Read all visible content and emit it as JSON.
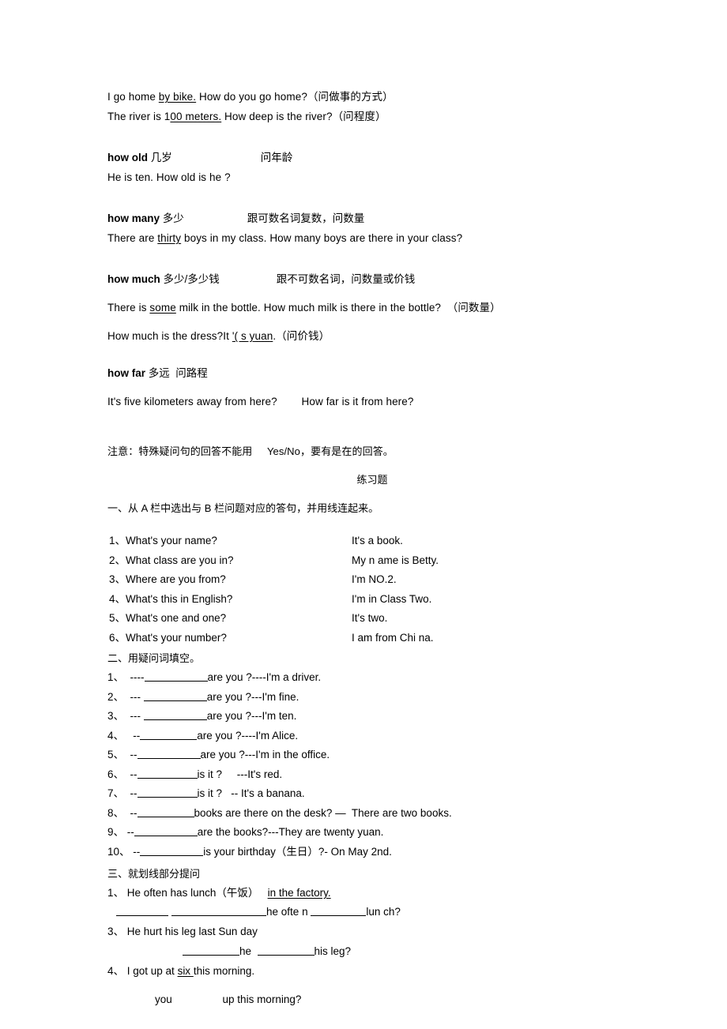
{
  "document": {
    "intro_examples": [
      {
        "pre": "I go home ",
        "underlined": "by bike.",
        "post": " How do you go home?（问做事的方式）"
      },
      {
        "pre": "The river is 1",
        "underlined": "00 meters.",
        "post": " How deep is the river?（问程度）"
      }
    ],
    "entries": [
      {
        "term": "how old",
        "cn_meaning": " 几岁",
        "note": "问年龄",
        "examples": [
          "He is ten. How old is he ?"
        ]
      },
      {
        "term": "how many",
        "cn_meaning": " 多少",
        "note": "跟可数名词复数，问数量",
        "examples": [
          "There are thirty boys in my class. How many boys are there in your class?"
        ],
        "example_underline": "thirty"
      },
      {
        "term": "how much",
        "cn_meaning": " 多少/多少钱",
        "note": "跟不可数名词，问数量或价钱",
        "examples": [
          "There is some milk in the bottle. How much milk is there in the bottle?（问数量）",
          "How much is the dress?"
        ]
      },
      {
        "term": "how far",
        "cn_meaning": " 多远  问路程",
        "note": "",
        "examples": [
          "It's five kilometers away from here?        How far is it from here?"
        ]
      }
    ],
    "how_much_extra": {
      "q": "How much is the dress?",
      "a_pre": "It ",
      "a_underlined": "'( s yuan",
      "a_post": ".（问价钱）"
    },
    "milk_example": {
      "pre": "There is ",
      "underlined": "some",
      "post": " milk in the bottle. How much milk is there in the bottle?  （问数量）"
    },
    "many_example": {
      "pre": "There are ",
      "underlined": "thirty",
      "post": " boys in my class. How many boys are there in your class?"
    },
    "note_line": "注意：特殊疑问句的回答不能用     Yes/No，要有是在的回答。",
    "practice_title": "练习题",
    "section_one": {
      "heading": "一、从 A 栏中选出与 B 栏问题对应的答句，并用线连起来。",
      "rows": [
        {
          "left": "1、What's your name?",
          "right": "It's a book."
        },
        {
          "left": "2、What class are you in?",
          "right": "My n ame is Betty."
        },
        {
          "left": "3、Where are you from?",
          "right": "I'm NO.2."
        },
        {
          "left": "4、What's this in English?",
          "right": "I'm in Class Two."
        },
        {
          "left": "5、What's one and one?",
          "right": "It's two."
        },
        {
          "left": "6、What's your number?",
          "right": "I am from Chi na."
        }
      ]
    },
    "section_two": {
      "heading": "二、用疑问词填空。",
      "items": [
        {
          "num": "1、",
          "pre": "  ----",
          "blank": 80,
          "post": "are you ?----I'm a driver."
        },
        {
          "num": "2、",
          "pre": "  --- ",
          "blank": 80,
          "post": "are you ?---I'm fine."
        },
        {
          "num": "3、",
          "pre": "  --- ",
          "blank": 80,
          "post": "are you ?---I'm ten."
        },
        {
          "num": "4、",
          "pre": "   --",
          "blank": 72,
          "post": "are you ?----I'm Alice."
        },
        {
          "num": "5、",
          "pre": "  --",
          "blank": 80,
          "post": "are you ?---I'm in the office."
        },
        {
          "num": "6、",
          "pre": "  --",
          "blank": 76,
          "post": "is it ?     ---It's red."
        },
        {
          "num": "7、",
          "pre": "  --",
          "blank": 76,
          "post": "is it ?   -- It's a banana."
        },
        {
          "num": "8、",
          "pre": "  --",
          "blank": 72,
          "post": "books are there on the desk? —  There are two books."
        },
        {
          "num": "9、",
          "pre": " --",
          "blank": 80,
          "post": "are the books?---They are twenty yuan."
        },
        {
          "num": "10、",
          "pre": " --",
          "blank": 80,
          "post": "is your birthday（生日）?‐ On May 2nd."
        }
      ]
    },
    "section_three": {
      "heading": "三、就划线部分提问",
      "items": [
        {
          "num": "1、",
          "text_pre": " He often has lunch（午饭）   ",
          "text_underlined": "in the factory.",
          "answer_pre": "   ",
          "answer_mid": "he ofte n ",
          "answer_post": "lun ch?"
        },
        {
          "num": "3、",
          "text_pre": " He hurt his leg last Sun day",
          "text_underlined": "",
          "answer_mid": "he  ",
          "answer_post": "his leg?"
        },
        {
          "num": "4、",
          "text_pre": " I got up at ",
          "text_underlined": "six ",
          "text_post": "this morning.",
          "answer_free": "                you                 up this morning?"
        }
      ]
    }
  }
}
